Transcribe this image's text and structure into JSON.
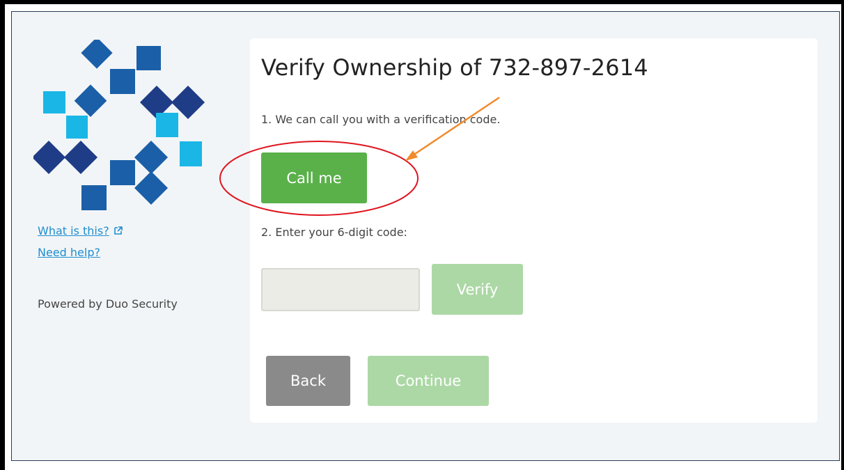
{
  "page": {
    "title": "Verify Ownership of 732-897-2614"
  },
  "sidebar": {
    "what_is_this": "What is this?",
    "need_help": "Need help?",
    "powered_by": "Powered by Duo Security"
  },
  "steps": {
    "step1": "1. We can call you with a verification code.",
    "step2": "2. Enter your 6-digit code:"
  },
  "buttons": {
    "call_me": "Call me",
    "verify": "Verify",
    "back": "Back",
    "continue": "Continue"
  },
  "code_input": {
    "value": "",
    "placeholder": ""
  },
  "colors": {
    "primary_green": "#5ab14a",
    "disabled_green": "#acd8a5",
    "back_gray": "#8a8a8a",
    "link_blue": "#1f8ecf",
    "logo_dark": "#1f3c87",
    "logo_mid": "#1b5fa8",
    "logo_light": "#1ab6e6",
    "annotation_red": "#e0141e",
    "annotation_orange": "#f08a2c"
  },
  "icons": {
    "logo": "duo-logo-icon",
    "external_link": "external-link-icon"
  }
}
